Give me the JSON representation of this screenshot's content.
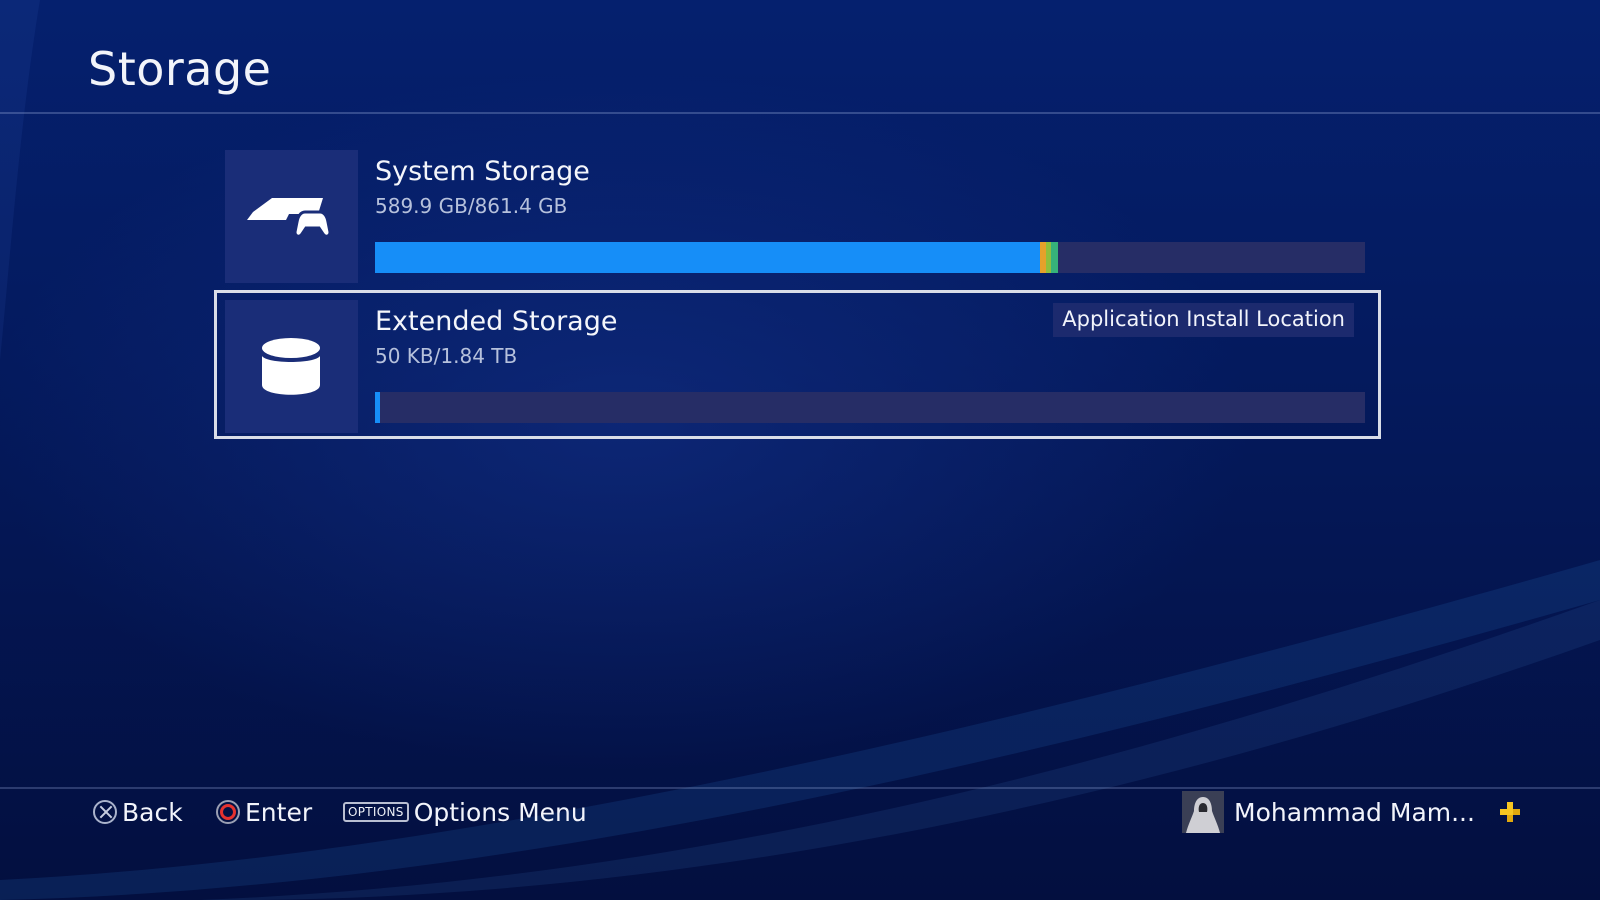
{
  "page": {
    "title": "Storage"
  },
  "storage": [
    {
      "name": "System Storage",
      "size": "589.9 GB/861.4 GB",
      "icon": "console-controller-icon",
      "usage": [
        {
          "color": "#168ef8",
          "fraction": 0.672
        },
        {
          "color": "#e6a12a",
          "fraction": 0.006
        },
        {
          "color": "#8fbf3c",
          "fraction": 0.005
        },
        {
          "color": "#36b27a",
          "fraction": 0.007
        }
      ]
    },
    {
      "name": "Extended Storage",
      "size": "50 KB/1.84 TB",
      "icon": "external-drive-icon",
      "badge": "Application Install Location",
      "usage": [
        {
          "color": "#168ef8",
          "fraction": 0.005
        }
      ]
    }
  ],
  "footer": {
    "back_label": "Back",
    "enter_label": "Enter",
    "options_key": "OPTIONS",
    "options_label": "Options Menu",
    "back_icon": "cross-button-icon",
    "enter_icon": "circle-button-icon"
  },
  "user": {
    "name": "Mohammad Mam...",
    "plus_color": "#f6c521"
  },
  "colors": {
    "accent_bar": "#168ef8",
    "focus_border": "#d9dde8"
  }
}
